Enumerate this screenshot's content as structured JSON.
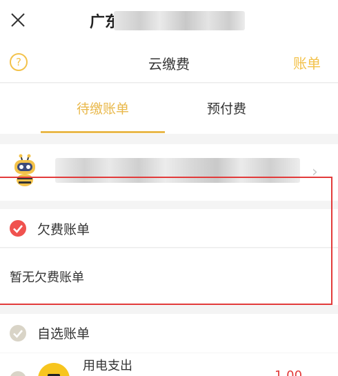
{
  "topbar": {
    "title_prefix": "广东"
  },
  "header": {
    "help_symbol": "?",
    "title": "云缴费",
    "bill_link": "账单"
  },
  "tabs": [
    {
      "label": "待缴账单",
      "active": true
    },
    {
      "label": "预付费",
      "active": false
    }
  ],
  "account": {
    "chevron": "›"
  },
  "owed_section": {
    "label": "欠费账单",
    "empty_text": "暂无欠费账单"
  },
  "optional_section": {
    "label": "自选账单",
    "item": {
      "title": "用电支出",
      "amount": "1.00"
    }
  },
  "colors": {
    "accent": "#e9b84a",
    "check_active": "#f0524f",
    "check_inactive": "#d9d4c7",
    "highlight_box": "#e23a3a"
  }
}
